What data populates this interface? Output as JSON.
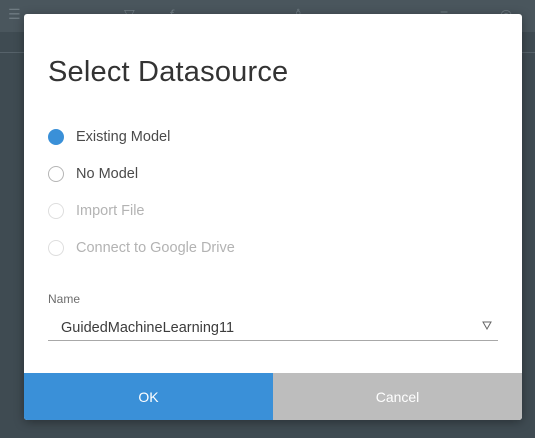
{
  "dialog": {
    "title": "Select Datasource",
    "options": [
      {
        "label": "Existing Model",
        "checked": true,
        "disabled": false
      },
      {
        "label": "No Model",
        "checked": false,
        "disabled": false
      },
      {
        "label": "Import File",
        "checked": false,
        "disabled": true
      },
      {
        "label": "Connect to Google Drive",
        "checked": false,
        "disabled": true
      }
    ],
    "name_label": "Name",
    "name_value": "GuidedMachineLearning11",
    "ok_label": "OK",
    "cancel_label": "Cancel"
  },
  "colors": {
    "accent": "#3a90d8",
    "cancel": "#bdbdbd",
    "backdrop": "#3f4b52"
  }
}
